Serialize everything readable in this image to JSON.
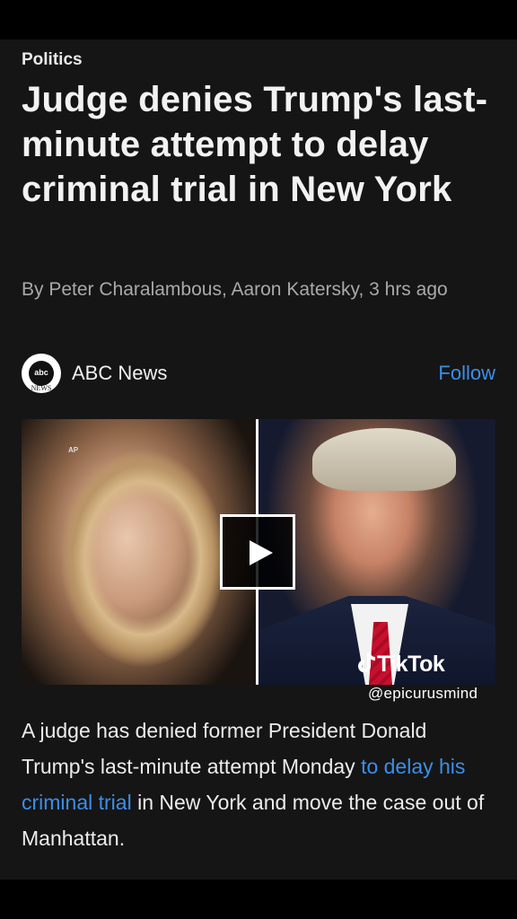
{
  "article": {
    "category": "Politics",
    "headline": "Judge denies Trump's last-minute attempt to delay criminal trial in New York",
    "byline": "By Peter Charalambous, Aaron Katersky, 3 hrs ago"
  },
  "source": {
    "logo_top": "abc",
    "logo_bottom": "NEWS",
    "name": "ABC News",
    "follow_label": "Follow"
  },
  "media": {
    "photo_credit": "AP",
    "play_icon": "play-icon",
    "watermark": "TikTok",
    "watermark_handle": "@epicurusmind"
  },
  "body": {
    "text_before": "A judge has denied former President Donald Trump's last-minute attempt Monday ",
    "link_text": "to delay his criminal trial",
    "text_after": " in New York and move the case out of Manhattan."
  },
  "colors": {
    "background": "#151515",
    "link": "#3d8ee8",
    "text": "#f2f2f2",
    "byline": "#a9a9a9"
  }
}
